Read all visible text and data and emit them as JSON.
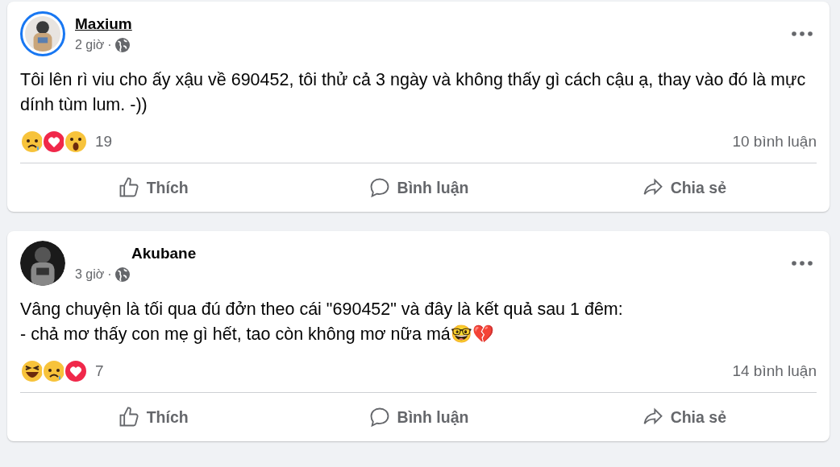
{
  "posts": [
    {
      "author": "Maxium",
      "underlined": true,
      "avatar_ring": true,
      "time": "2 giờ",
      "separator": "·",
      "text": "Tôi lên rì viu cho ấy xậu về 690452, tôi thử cả 3 ngày và không thấy gì cách cậu ạ, thay vào đó là mực dính tùm lum. -))",
      "reactions": [
        {
          "kind": "sad"
        },
        {
          "kind": "love"
        },
        {
          "kind": "wow"
        }
      ],
      "reaction_count": "19",
      "comments": "10 bình luận",
      "actions": [
        "Thích",
        "Bình luận",
        "Chia sẻ"
      ]
    },
    {
      "author": "Akubane",
      "underlined": false,
      "avatar_ring": false,
      "time": "3 giờ",
      "separator": "·",
      "text": "Vâng chuyện là tối qua đú đởn theo cái \"690452\" và đây là kết quả sau 1 đêm:\n- chả mơ thấy con mẹ gì hết, tao còn không mơ nữa má🤓💔",
      "reactions": [
        {
          "kind": "haha"
        },
        {
          "kind": "sad"
        },
        {
          "kind": "love"
        }
      ],
      "reaction_count": "7",
      "comments": "14 bình luận",
      "actions": [
        "Thích",
        "Bình luận",
        "Chia sẻ"
      ]
    }
  ]
}
